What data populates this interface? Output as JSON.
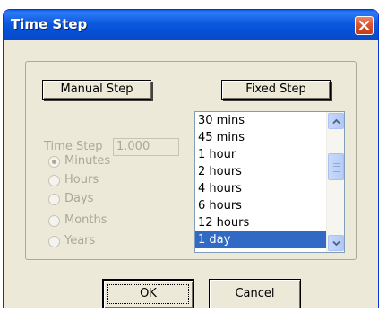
{
  "window": {
    "title": "Time Step"
  },
  "mode_buttons": {
    "manual_label": "Manual Step",
    "fixed_label": "Fixed Step"
  },
  "manual": {
    "time_step_label": "Time Step",
    "time_step_value": "1.000",
    "units": [
      {
        "label": "Minutes",
        "checked": true
      },
      {
        "label": "Hours",
        "checked": false
      },
      {
        "label": "Days",
        "checked": false
      },
      {
        "label": "Months",
        "checked": false
      },
      {
        "label": "Years",
        "checked": false
      }
    ]
  },
  "fixed": {
    "items": [
      "30 mins",
      "45 mins",
      "1 hour",
      "2 hours",
      "4 hours",
      "6 hours",
      "12 hours",
      "1 day"
    ],
    "selected": "1 day"
  },
  "footer": {
    "ok_label": "OK",
    "cancel_label": "Cancel"
  },
  "colors": {
    "title_bar": "#0a58e0",
    "close_button": "#dc5430",
    "dialog_face": "#ece9d8",
    "selection": "#316ac5",
    "disabled_text": "#aca899"
  }
}
